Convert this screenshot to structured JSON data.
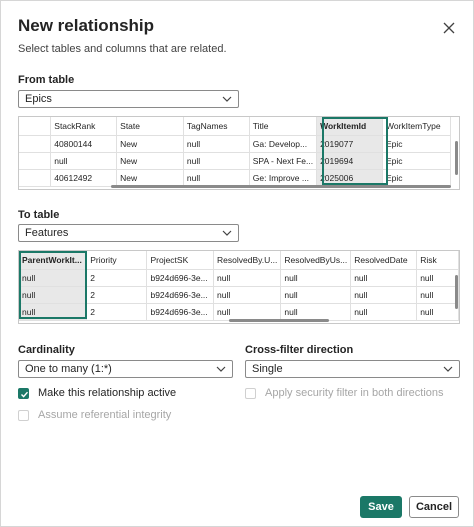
{
  "dialog": {
    "title": "New relationship",
    "subtitle": "Select tables and columns that are related."
  },
  "from_table": {
    "label": "From table",
    "selected": "Epics",
    "columns": [
      "",
      "StackRank",
      "State",
      "TagNames",
      "Title",
      "WorkItemId",
      "WorkItemType"
    ],
    "rows": [
      [
        "",
        "40800144",
        "New",
        "null",
        "Ga: Develop...",
        "2019077",
        "Epic"
      ],
      [
        "",
        "null",
        "New",
        "null",
        "SPA - Next Fe...",
        "2019694",
        "Epic"
      ],
      [
        "",
        "40612492",
        "New",
        "null",
        "Ge: Improve ...",
        "2025006",
        "Epic"
      ]
    ],
    "selected_column": "WorkItemId"
  },
  "to_table": {
    "label": "To table",
    "selected": "Features",
    "columns": [
      "ParentWorkIt...",
      "Priority",
      "ProjectSK",
      "ResolvedBy.U...",
      "ResolvedByUs...",
      "ResolvedDate",
      "Risk"
    ],
    "rows": [
      [
        "null",
        "2",
        "b924d696-3e...",
        "null",
        "null",
        "null",
        "null"
      ],
      [
        "null",
        "2",
        "b924d696-3e...",
        "null",
        "null",
        "null",
        "null"
      ],
      [
        "null",
        "2",
        "b924d696-3e...",
        "null",
        "null",
        "null",
        "null"
      ]
    ],
    "selected_column": "ParentWorkIt..."
  },
  "cardinality": {
    "label": "Cardinality",
    "selected": "One to many (1:*)"
  },
  "cross_filter": {
    "label": "Cross-filter direction",
    "selected": "Single"
  },
  "options": {
    "active_label": "Make this relationship active",
    "active_checked": true,
    "referential_label": "Assume referential integrity",
    "referential_checked": false,
    "security_label": "Apply security filter in both directions",
    "security_checked": false
  },
  "buttons": {
    "save": "Save",
    "cancel": "Cancel"
  },
  "colors": {
    "accent": "#1b7867",
    "border": "#8a8a8a",
    "disabled_text": "#a6a6a6"
  },
  "icons": {
    "close": "close-icon",
    "dropdown": "chevron-down-icon",
    "check": "checkmark-icon"
  }
}
